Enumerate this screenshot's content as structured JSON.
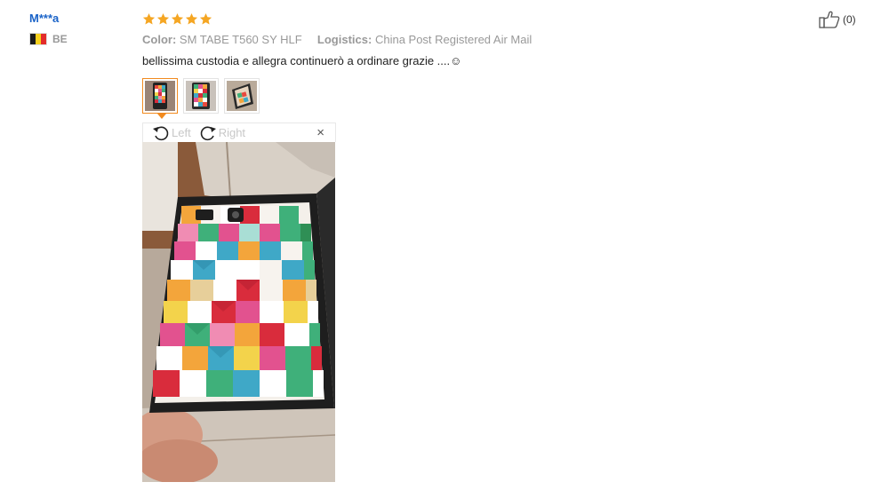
{
  "review": {
    "user_name": "M***a",
    "country": "BE",
    "rating": 5,
    "color_label": "Color:",
    "color_value": "SM TABE T560 SY HLF",
    "logistics_label": "Logistics:",
    "logistics_value": "China Post Registered Air Mail",
    "text": "bellissima custodia e allegra continuerò a ordinare grazie ....☺",
    "likes": "(0)"
  },
  "viewer": {
    "left_label": "Left",
    "right_label": "Right",
    "close": "×"
  },
  "colors": {
    "username": "#1a63c8",
    "star": "#f5a623",
    "active_thumb": "#f28a1e",
    "flag": [
      "#1c1c1c",
      "#f7d11e",
      "#e32b2b"
    ]
  }
}
